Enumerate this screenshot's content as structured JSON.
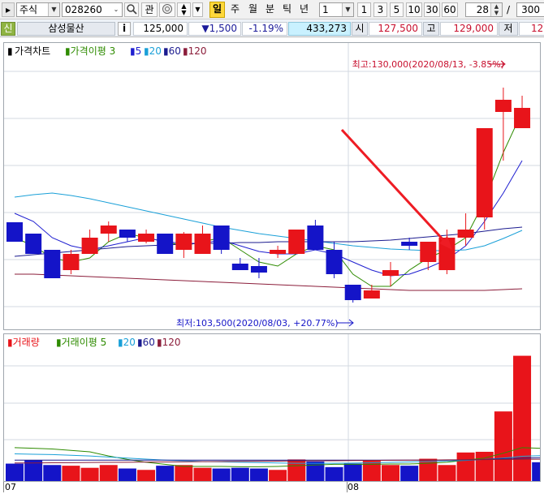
{
  "toolbar": {
    "market_select": "주식",
    "stock_code": "028260",
    "gwan_label": "관",
    "period_buttons": [
      "일",
      "주",
      "월",
      "분",
      "틱",
      "년"
    ],
    "interval_value": "1",
    "interval_buttons": [
      "1",
      "3",
      "5",
      "10",
      "30",
      "60"
    ],
    "count_value": "28",
    "count_separator": "/",
    "count_total": "300"
  },
  "quote": {
    "credit_badge": "신",
    "stock_name": "삼성물산",
    "info_button": "i",
    "price": "125,000",
    "change": "▼1,500",
    "change_pct": "-1.19%",
    "volume": "433,273",
    "open_label": "시",
    "open_value": "127,500",
    "high_label": "고",
    "high_value": "129,000",
    "low_label": "저",
    "low_value": "12"
  },
  "price_panel": {
    "legend_title": "가격차트",
    "legend_ma_label": "가격이평",
    "legend_periods": [
      "3",
      "5",
      "20",
      "60",
      "120"
    ],
    "high_annotation": "최고:130,000(2020/08/13, -3.85%)",
    "low_annotation": "최저:103,500(2020/08/03, +20.77%)"
  },
  "volume_panel": {
    "legend_title": "거래량",
    "legend_ma_label": "거래이평",
    "legend_periods": [
      "5",
      "20",
      "60",
      "120"
    ]
  },
  "xaxis": {
    "label_jul": "07",
    "label_aug": "08"
  },
  "colors": {
    "up": "#e8141a",
    "down": "#1414c8",
    "ma3": "#2e8b00",
    "ma5": "#1f1fd0",
    "ma20": "#1aa0d8",
    "ma60": "#1b1b8f",
    "ma120": "#8b1d3a",
    "arrow": "#ee1c24"
  },
  "chart_data": {
    "type": "candlestick",
    "ylim": [
      101000,
      133500
    ],
    "series": [
      {
        "name": "가격차트",
        "ohlc": [
          [
            113400,
            113400,
            111000,
            111000
          ],
          [
            112000,
            112000,
            109500,
            109500
          ],
          [
            110000,
            110000,
            106500,
            106500
          ],
          [
            107500,
            110000,
            107000,
            109500
          ],
          [
            109500,
            112500,
            109500,
            111500
          ],
          [
            112000,
            113500,
            111000,
            113000
          ],
          [
            112500,
            112500,
            111000,
            111500
          ],
          [
            111000,
            112500,
            110800,
            112000
          ],
          [
            112000,
            112000,
            109500,
            109500
          ],
          [
            110000,
            112200,
            109000,
            112000
          ],
          [
            109500,
            113000,
            109500,
            112000
          ],
          [
            113000,
            113000,
            109500,
            110000
          ],
          [
            108300,
            109000,
            107500,
            107500
          ],
          [
            108000,
            109000,
            106500,
            107200
          ],
          [
            109500,
            110500,
            109000,
            110000
          ],
          [
            109500,
            112500,
            109500,
            112500
          ],
          [
            113000,
            113700,
            110000,
            110000
          ],
          [
            110000,
            111000,
            106500,
            107000
          ],
          [
            105700,
            105700,
            103500,
            103800
          ],
          [
            104000,
            105700,
            104000,
            105000
          ],
          [
            106800,
            108500,
            105500,
            107500
          ],
          [
            111000,
            111500,
            110000,
            110500
          ],
          [
            108500,
            111000,
            107500,
            111000
          ],
          [
            107500,
            112500,
            107000,
            111500
          ],
          [
            111500,
            114500,
            110500,
            112500
          ],
          [
            114000,
            125000,
            112500,
            125000
          ],
          [
            127000,
            130000,
            121000,
            128500
          ],
          [
            125000,
            129000,
            125000,
            127500
          ]
        ]
      },
      {
        "name": "3",
        "values": [
          111500,
          110500,
          109000,
          108500,
          109000,
          111000,
          112000,
          111500,
          111000,
          110500,
          111000,
          111500,
          110000,
          108500,
          108000,
          109500,
          110500,
          110000,
          107000,
          105500,
          105500,
          107500,
          109000,
          110000,
          111500,
          116000,
          122000,
          127000
        ]
      },
      {
        "name": "5",
        "values": [
          114500,
          113500,
          111500,
          110500,
          110000,
          110500,
          111000,
          111500,
          111000,
          110800,
          110800,
          111200,
          110500,
          109800,
          109500,
          109500,
          110000,
          109500,
          108500,
          107500,
          106800,
          107000,
          107800,
          108800,
          110500,
          113500,
          117000,
          121000
        ]
      },
      {
        "name": "20",
        "values": [
          116500,
          116800,
          117000,
          116700,
          116300,
          115800,
          115300,
          114800,
          114300,
          113800,
          113300,
          112800,
          112400,
          112000,
          111700,
          111400,
          111100,
          110800,
          110500,
          110300,
          110100,
          110000,
          109900,
          109900,
          110000,
          110500,
          111400,
          112400
        ]
      },
      {
        "name": "60",
        "values": [
          109200,
          109400,
          109600,
          109800,
          110000,
          110200,
          110400,
          110500,
          110600,
          110700,
          110800,
          110800,
          110900,
          110900,
          111000,
          111000,
          111000,
          111000,
          111000,
          111100,
          111200,
          111400,
          111600,
          111800,
          112000,
          112300,
          112600,
          112800
        ]
      },
      {
        "name": "120",
        "values": [
          107000,
          107000,
          106900,
          106800,
          106700,
          106600,
          106500,
          106400,
          106300,
          106200,
          106100,
          106000,
          105900,
          105800,
          105700,
          105600,
          105500,
          105400,
          105300,
          105200,
          105100,
          105000,
          105000,
          105000,
          105000,
          105000,
          105100,
          105200
        ]
      }
    ],
    "volume": {
      "ylim": [
        0,
        1900000
      ],
      "values": [
        250000,
        300000,
        230000,
        220000,
        190000,
        230000,
        180000,
        160000,
        220000,
        230000,
        190000,
        180000,
        190000,
        180000,
        160000,
        310000,
        280000,
        200000,
        250000,
        290000,
        230000,
        220000,
        320000,
        230000,
        410000,
        420000,
        1000000,
        1800000,
        270000
      ],
      "ma5": [
        480000,
        470000,
        460000,
        440000,
        420000,
        360000,
        310000,
        270000,
        240000,
        210000,
        210000,
        210000,
        205000,
        205000,
        210000,
        220000,
        230000,
        240000,
        240000,
        240000,
        245000,
        245000,
        255000,
        270000,
        300000,
        330000,
        400000,
        480000,
        470000
      ],
      "ma20": [
        390000,
        385000,
        380000,
        370000,
        360000,
        345000,
        330000,
        315000,
        300000,
        290000,
        280000,
        275000,
        270000,
        265000,
        260000,
        255000,
        255000,
        255000,
        258000,
        262000,
        268000,
        274000,
        280000,
        288000,
        296000,
        310000,
        330000,
        355000,
        365000
      ],
      "ma60": [
        300000,
        300000,
        300000,
        300000,
        300000,
        300000,
        300000,
        300000,
        300000,
        300000,
        300000,
        300000,
        300000,
        300000,
        300000,
        300000,
        300000,
        300000,
        300000,
        300000,
        300000,
        300000,
        300000,
        300000,
        305000,
        310000,
        320000,
        330000,
        335000
      ],
      "ma120": [
        260000,
        260000,
        262000,
        264000,
        266000,
        268000,
        270000,
        272000,
        274000,
        276000,
        278000,
        280000,
        282000,
        284000,
        286000,
        288000,
        290000,
        292000,
        294000,
        296000,
        298000,
        300000,
        302000,
        304000,
        306000,
        308000,
        310000,
        312000,
        314000
      ]
    }
  }
}
